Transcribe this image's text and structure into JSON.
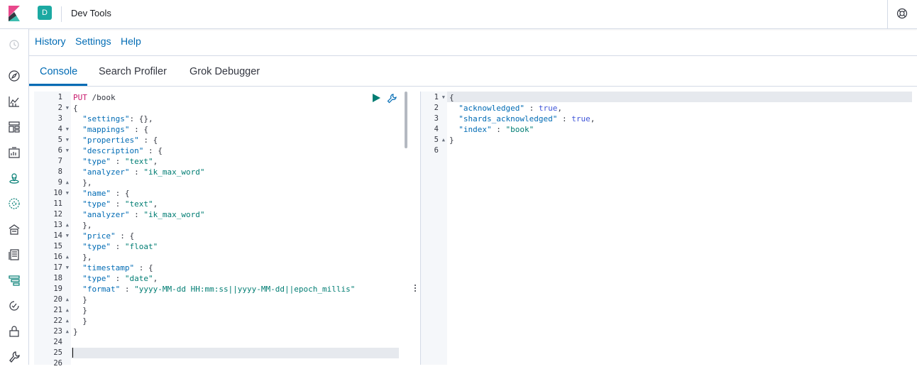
{
  "header": {
    "space_initial": "D",
    "app_title": "Dev Tools",
    "logo_icon": "kibana-logo-icon",
    "help_icon": "lifebuoy-icon"
  },
  "sidenav": {
    "icons": [
      "recently-viewed-icon",
      "discover-icon",
      "visualize-icon",
      "dashboard-icon",
      "canvas-icon",
      "maps-icon",
      "ml-icon",
      "infrastructure-icon",
      "logs-icon",
      "apm-icon",
      "uptime-icon",
      "siem-icon",
      "dev-tools-icon"
    ]
  },
  "subnav": {
    "history": "History",
    "settings": "Settings",
    "help": "Help"
  },
  "tabs": {
    "console": "Console",
    "search_profiler": "Search Profiler",
    "grok_debugger": "Grok Debugger",
    "active": "Console"
  },
  "request": {
    "lines": [
      {
        "n": "1",
        "fold": "",
        "text": ""
      },
      {
        "n": "2",
        "fold": "▼",
        "text": "{"
      },
      {
        "n": "3",
        "fold": "",
        "text": "  \"settings\": {},"
      },
      {
        "n": "4",
        "fold": "▼",
        "text": "  \"mappings\" : {"
      },
      {
        "n": "5",
        "fold": "▼",
        "text": "  \"properties\" : {"
      },
      {
        "n": "6",
        "fold": "▼",
        "text": "  \"description\" : {"
      },
      {
        "n": "7",
        "fold": "",
        "text": "  \"type\" : \"text\","
      },
      {
        "n": "8",
        "fold": "",
        "text": "  \"analyzer\" : \"ik_max_word\""
      },
      {
        "n": "9",
        "fold": "▲",
        "text": "  },"
      },
      {
        "n": "10",
        "fold": "▼",
        "text": "  \"name\" : {"
      },
      {
        "n": "11",
        "fold": "",
        "text": "  \"type\" : \"text\","
      },
      {
        "n": "12",
        "fold": "",
        "text": "  \"analyzer\" : \"ik_max_word\""
      },
      {
        "n": "13",
        "fold": "▲",
        "text": "  },"
      },
      {
        "n": "14",
        "fold": "▼",
        "text": "  \"price\" : {"
      },
      {
        "n": "15",
        "fold": "",
        "text": "  \"type\" : \"float\""
      },
      {
        "n": "16",
        "fold": "▲",
        "text": "  },"
      },
      {
        "n": "17",
        "fold": "▼",
        "text": "  \"timestamp\" : {"
      },
      {
        "n": "18",
        "fold": "",
        "text": "  \"type\" : \"date\","
      },
      {
        "n": "19",
        "fold": "",
        "text": "  \"format\" : \"yyyy-MM-dd HH:mm:ss||yyyy-MM-dd||epoch_millis\""
      },
      {
        "n": "20",
        "fold": "▲",
        "text": "  }"
      },
      {
        "n": "21",
        "fold": "▲",
        "text": "  }"
      },
      {
        "n": "22",
        "fold": "▲",
        "text": "  }"
      },
      {
        "n": "23",
        "fold": "▲",
        "text": "}"
      },
      {
        "n": "24",
        "fold": "",
        "text": ""
      },
      {
        "n": "25",
        "fold": "",
        "text": ""
      },
      {
        "n": "26",
        "fold": "",
        "text": ""
      }
    ],
    "method": "PUT",
    "path": " /book",
    "cursor_line": 25
  },
  "response": {
    "lines": [
      {
        "n": "1",
        "fold": "▼",
        "text": "{"
      },
      {
        "n": "2",
        "fold": "",
        "text": "  \"acknowledged\" : true,"
      },
      {
        "n": "3",
        "fold": "",
        "text": "  \"shards_acknowledged\" : true,"
      },
      {
        "n": "4",
        "fold": "",
        "text": "  \"index\" : \"book\""
      },
      {
        "n": "5",
        "fold": "▲",
        "text": "}"
      },
      {
        "n": "6",
        "fold": "",
        "text": ""
      }
    ]
  },
  "colors": {
    "accent": "#006bb4",
    "method": "#c81a6d",
    "string": "#017d73",
    "boolean": "#3f55d8",
    "space_badge": "#1ba9a2"
  }
}
